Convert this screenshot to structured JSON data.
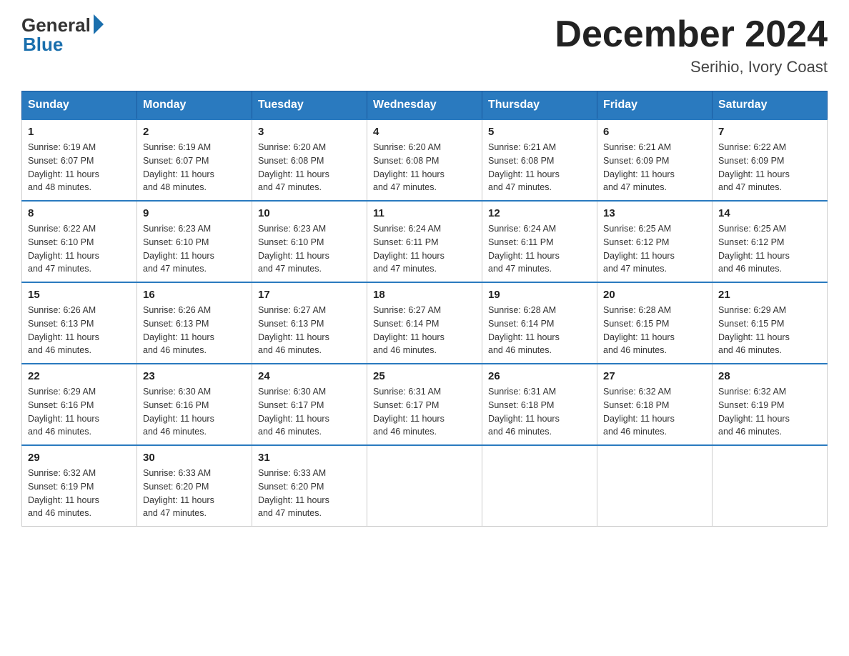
{
  "logo": {
    "general": "General",
    "blue": "Blue"
  },
  "title": {
    "month_year": "December 2024",
    "location": "Serihio, Ivory Coast"
  },
  "headers": [
    "Sunday",
    "Monday",
    "Tuesday",
    "Wednesday",
    "Thursday",
    "Friday",
    "Saturday"
  ],
  "weeks": [
    [
      {
        "day": "1",
        "sunrise": "6:19 AM",
        "sunset": "6:07 PM",
        "daylight": "11 hours and 48 minutes."
      },
      {
        "day": "2",
        "sunrise": "6:19 AM",
        "sunset": "6:07 PM",
        "daylight": "11 hours and 48 minutes."
      },
      {
        "day": "3",
        "sunrise": "6:20 AM",
        "sunset": "6:08 PM",
        "daylight": "11 hours and 47 minutes."
      },
      {
        "day": "4",
        "sunrise": "6:20 AM",
        "sunset": "6:08 PM",
        "daylight": "11 hours and 47 minutes."
      },
      {
        "day": "5",
        "sunrise": "6:21 AM",
        "sunset": "6:08 PM",
        "daylight": "11 hours and 47 minutes."
      },
      {
        "day": "6",
        "sunrise": "6:21 AM",
        "sunset": "6:09 PM",
        "daylight": "11 hours and 47 minutes."
      },
      {
        "day": "7",
        "sunrise": "6:22 AM",
        "sunset": "6:09 PM",
        "daylight": "11 hours and 47 minutes."
      }
    ],
    [
      {
        "day": "8",
        "sunrise": "6:22 AM",
        "sunset": "6:10 PM",
        "daylight": "11 hours and 47 minutes."
      },
      {
        "day": "9",
        "sunrise": "6:23 AM",
        "sunset": "6:10 PM",
        "daylight": "11 hours and 47 minutes."
      },
      {
        "day": "10",
        "sunrise": "6:23 AM",
        "sunset": "6:10 PM",
        "daylight": "11 hours and 47 minutes."
      },
      {
        "day": "11",
        "sunrise": "6:24 AM",
        "sunset": "6:11 PM",
        "daylight": "11 hours and 47 minutes."
      },
      {
        "day": "12",
        "sunrise": "6:24 AM",
        "sunset": "6:11 PM",
        "daylight": "11 hours and 47 minutes."
      },
      {
        "day": "13",
        "sunrise": "6:25 AM",
        "sunset": "6:12 PM",
        "daylight": "11 hours and 47 minutes."
      },
      {
        "day": "14",
        "sunrise": "6:25 AM",
        "sunset": "6:12 PM",
        "daylight": "11 hours and 46 minutes."
      }
    ],
    [
      {
        "day": "15",
        "sunrise": "6:26 AM",
        "sunset": "6:13 PM",
        "daylight": "11 hours and 46 minutes."
      },
      {
        "day": "16",
        "sunrise": "6:26 AM",
        "sunset": "6:13 PM",
        "daylight": "11 hours and 46 minutes."
      },
      {
        "day": "17",
        "sunrise": "6:27 AM",
        "sunset": "6:13 PM",
        "daylight": "11 hours and 46 minutes."
      },
      {
        "day": "18",
        "sunrise": "6:27 AM",
        "sunset": "6:14 PM",
        "daylight": "11 hours and 46 minutes."
      },
      {
        "day": "19",
        "sunrise": "6:28 AM",
        "sunset": "6:14 PM",
        "daylight": "11 hours and 46 minutes."
      },
      {
        "day": "20",
        "sunrise": "6:28 AM",
        "sunset": "6:15 PM",
        "daylight": "11 hours and 46 minutes."
      },
      {
        "day": "21",
        "sunrise": "6:29 AM",
        "sunset": "6:15 PM",
        "daylight": "11 hours and 46 minutes."
      }
    ],
    [
      {
        "day": "22",
        "sunrise": "6:29 AM",
        "sunset": "6:16 PM",
        "daylight": "11 hours and 46 minutes."
      },
      {
        "day": "23",
        "sunrise": "6:30 AM",
        "sunset": "6:16 PM",
        "daylight": "11 hours and 46 minutes."
      },
      {
        "day": "24",
        "sunrise": "6:30 AM",
        "sunset": "6:17 PM",
        "daylight": "11 hours and 46 minutes."
      },
      {
        "day": "25",
        "sunrise": "6:31 AM",
        "sunset": "6:17 PM",
        "daylight": "11 hours and 46 minutes."
      },
      {
        "day": "26",
        "sunrise": "6:31 AM",
        "sunset": "6:18 PM",
        "daylight": "11 hours and 46 minutes."
      },
      {
        "day": "27",
        "sunrise": "6:32 AM",
        "sunset": "6:18 PM",
        "daylight": "11 hours and 46 minutes."
      },
      {
        "day": "28",
        "sunrise": "6:32 AM",
        "sunset": "6:19 PM",
        "daylight": "11 hours and 46 minutes."
      }
    ],
    [
      {
        "day": "29",
        "sunrise": "6:32 AM",
        "sunset": "6:19 PM",
        "daylight": "11 hours and 46 minutes."
      },
      {
        "day": "30",
        "sunrise": "6:33 AM",
        "sunset": "6:20 PM",
        "daylight": "11 hours and 47 minutes."
      },
      {
        "day": "31",
        "sunrise": "6:33 AM",
        "sunset": "6:20 PM",
        "daylight": "11 hours and 47 minutes."
      },
      null,
      null,
      null,
      null
    ]
  ],
  "labels": {
    "sunrise": "Sunrise:",
    "sunset": "Sunset:",
    "daylight": "Daylight:"
  }
}
